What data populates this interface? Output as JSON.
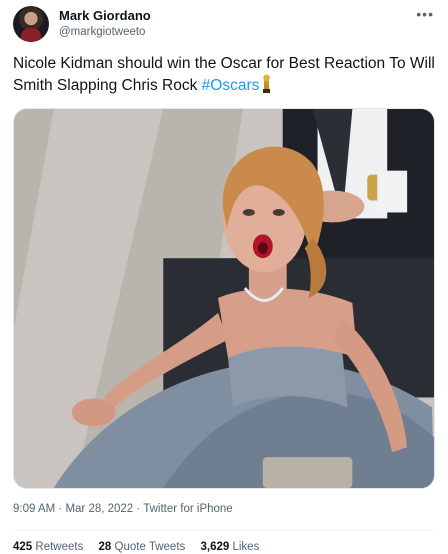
{
  "author": {
    "name": "Mark Giordano",
    "handle": "@markgiotweeto"
  },
  "tweet": {
    "text": "Nicole Kidman should win the Oscar for Best Reaction To Will Smith Slapping Chris Rock ",
    "hashtag": "#Oscars",
    "emoji_icon": "oscar-statuette-icon"
  },
  "meta": {
    "time": "9:09 AM",
    "separator1": " · ",
    "date": "Mar 28, 2022",
    "separator2": " · ",
    "source": "Twitter for iPhone"
  },
  "stats": {
    "retweets_count": "425",
    "retweets_label": "Retweets",
    "quotes_count": "28",
    "quotes_label": "Quote Tweets",
    "likes_count": "3,629",
    "likes_label": "Likes"
  },
  "colors": {
    "link": "#1d9bf0",
    "secondary_text": "#536471",
    "primary_text": "#0f1419"
  }
}
